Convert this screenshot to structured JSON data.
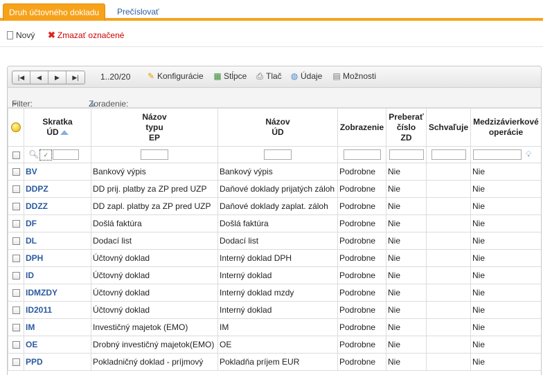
{
  "tabs": [
    {
      "label": "Druh účtovného dokladu",
      "active": true
    },
    {
      "label": "Prečíslovať",
      "active": false
    }
  ],
  "actions": {
    "new_label": "Nový",
    "delete_label": "Zmazať označené"
  },
  "toolbar": {
    "count": "1..20/20",
    "configuration": "Konfigurácie",
    "columns": "Stĺpce",
    "print": "Tlač",
    "data": "Údaje",
    "options": "Možnosti"
  },
  "filterbar": {
    "filter_label": "Filter:",
    "sort_label": "Zoradenie:"
  },
  "columns": {
    "code": [
      "Skratka",
      "ÚD"
    ],
    "ep_name": [
      "Názov",
      "typu",
      "EP"
    ],
    "ud_name": [
      "Názov",
      "ÚD"
    ],
    "display": [
      "Zobrazenie"
    ],
    "take_zd": [
      "Preberať",
      "číslo",
      "ZD"
    ],
    "approve": [
      "Schvaľuje"
    ],
    "inter": [
      "Medzizávierkové",
      "operácie"
    ]
  },
  "rows": [
    {
      "code": "BV",
      "ep_name": "Bankový výpis",
      "ud_name": "Bankový výpis",
      "display": "Podrobne",
      "take_zd": "Nie",
      "approve": "",
      "inter": "Nie"
    },
    {
      "code": "DDPZ",
      "ep_name": "DD prij. platby za ZP pred UZP",
      "ud_name": "Daňové doklady prijatých záloh",
      "display": "Podrobne",
      "take_zd": "Nie",
      "approve": "",
      "inter": "Nie"
    },
    {
      "code": "DDZZ",
      "ep_name": "DD zapl. platby za ZP pred UZP",
      "ud_name": "Daňové doklady zaplat. záloh",
      "display": "Podrobne",
      "take_zd": "Nie",
      "approve": "",
      "inter": "Nie"
    },
    {
      "code": "DF",
      "ep_name": "Došlá faktúra",
      "ud_name": "Došlá faktúra",
      "display": "Podrobne",
      "take_zd": "Nie",
      "approve": "",
      "inter": "Nie"
    },
    {
      "code": "DL",
      "ep_name": "Dodací list",
      "ud_name": "Dodací list",
      "display": "Podrobne",
      "take_zd": "Nie",
      "approve": "",
      "inter": "Nie"
    },
    {
      "code": "DPH",
      "ep_name": "Účtovný doklad",
      "ud_name": "Interný doklad DPH",
      "display": "Podrobne",
      "take_zd": "Nie",
      "approve": "",
      "inter": "Nie"
    },
    {
      "code": "ID",
      "ep_name": "Účtovný doklad",
      "ud_name": "Interný doklad",
      "display": "Podrobne",
      "take_zd": "Nie",
      "approve": "",
      "inter": "Nie"
    },
    {
      "code": "IDMZDY",
      "ep_name": "Účtovný doklad",
      "ud_name": "Interný doklad mzdy",
      "display": "Podrobne",
      "take_zd": "Nie",
      "approve": "",
      "inter": "Nie"
    },
    {
      "code": "ID2011",
      "ep_name": "Účtovný doklad",
      "ud_name": "Interný doklad",
      "display": "Podrobne",
      "take_zd": "Nie",
      "approve": "",
      "inter": "Nie"
    },
    {
      "code": "IM",
      "ep_name": "Investičný majetok (EMO)",
      "ud_name": "IM",
      "display": "Podrobne",
      "take_zd": "Nie",
      "approve": "",
      "inter": "Nie"
    },
    {
      "code": "OE",
      "ep_name": "Drobný investičný majetok(EMO)",
      "ud_name": "OE",
      "display": "Podrobne",
      "take_zd": "Nie",
      "approve": "",
      "inter": "Nie"
    },
    {
      "code": "PPD",
      "ep_name": "Pokladničný doklad - príjmový",
      "ud_name": "Pokladňa príjem EUR",
      "display": "Podrobne",
      "take_zd": "Nie",
      "approve": "",
      "inter": "Nie"
    }
  ]
}
